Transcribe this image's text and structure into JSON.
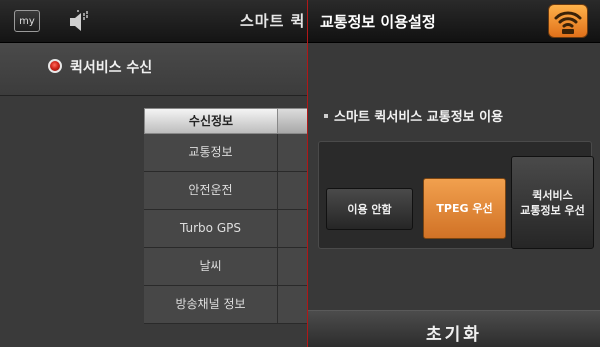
{
  "background_screen": {
    "my_label": "my",
    "title": "스마트 퀵",
    "quick_service_label": "퀵서비스 수신",
    "table": {
      "header": "수신정보",
      "rows": [
        "교통정보",
        "안전운전",
        "Turbo GPS",
        "날씨",
        "방송채널 정보"
      ]
    }
  },
  "popup": {
    "title": "교통정보 이용설정",
    "header_icon": "wifi-signal-icon",
    "section_label": "스마트 퀵서비스 교통정보 이용",
    "options": [
      {
        "label": "이용 안함",
        "selected": false
      },
      {
        "label": "TPEG 우선",
        "selected": true
      },
      {
        "label": "퀵서비스\n교통정보 우선",
        "selected": false
      }
    ],
    "reset_label": "초기화"
  },
  "colors": {
    "accent_orange": "#e0802a",
    "record_red": "#d0241a",
    "divider_red": "#b01818"
  }
}
